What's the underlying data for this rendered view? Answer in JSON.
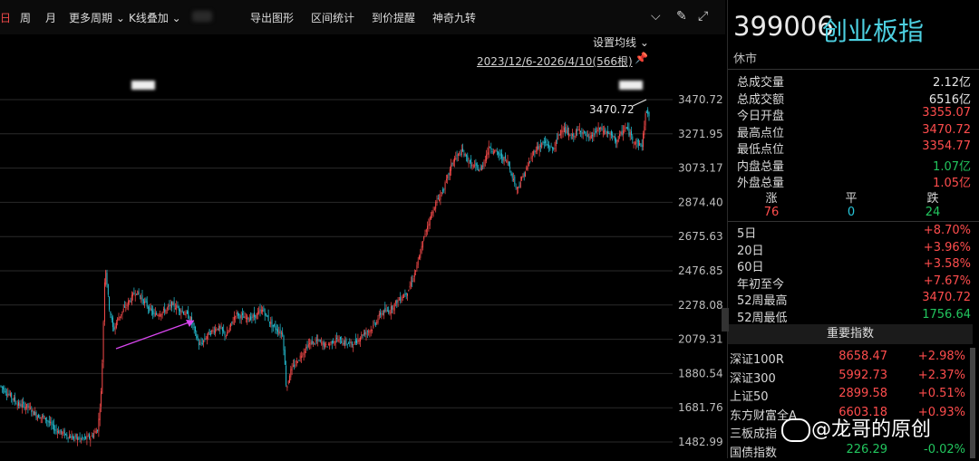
{
  "toolbar": {
    "period_partial": "日",
    "week": "周",
    "month": "月",
    "more_periods": "更多周期 ⌄",
    "kline_overlay": "K线叠加 ⌄",
    "export": "导出图形",
    "range_stats": "区间统计",
    "price_alert": "到价提醒",
    "magic_nine": "神奇九转"
  },
  "chart_header": {
    "ma_setting": "设置均线 ⌄",
    "date_range": "2023/12/6-2026/4/10(566根)"
  },
  "chart_data": {
    "type": "candlestick",
    "y_ticks": [
      "3470.72",
      "3271.95",
      "3073.17",
      "2874.40",
      "2675.63",
      "2476.85",
      "2278.08",
      "2079.31",
      "1880.54",
      "1681.76",
      "1482.99"
    ],
    "ylim": [
      1482.99,
      3470.72
    ],
    "annotation": "3470.72",
    "up_color": "#ff4d4d",
    "down_color": "#26c6da",
    "trend_arrow_color": "#d946ef",
    "path": [
      [
        0,
        1810
      ],
      [
        10,
        1760
      ],
      [
        20,
        1700
      ],
      [
        30,
        1690
      ],
      [
        40,
        1640
      ],
      [
        50,
        1620
      ],
      [
        60,
        1560
      ],
      [
        70,
        1530
      ],
      [
        80,
        1510
      ],
      [
        90,
        1500
      ],
      [
        100,
        1510
      ],
      [
        108,
        1560
      ],
      [
        112,
        1800
      ],
      [
        116,
        2530
      ],
      [
        120,
        2280
      ],
      [
        125,
        2130
      ],
      [
        130,
        2200
      ],
      [
        140,
        2280
      ],
      [
        150,
        2360
      ],
      [
        160,
        2290
      ],
      [
        170,
        2220
      ],
      [
        180,
        2240
      ],
      [
        190,
        2280
      ],
      [
        200,
        2250
      ],
      [
        210,
        2200
      ],
      [
        220,
        2040
      ],
      [
        230,
        2110
      ],
      [
        240,
        2150
      ],
      [
        250,
        2100
      ],
      [
        260,
        2230
      ],
      [
        270,
        2200
      ],
      [
        280,
        2210
      ],
      [
        290,
        2250
      ],
      [
        300,
        2160
      ],
      [
        312,
        2110
      ],
      [
        316,
        1790
      ],
      [
        320,
        1890
      ],
      [
        330,
        1970
      ],
      [
        340,
        2050
      ],
      [
        350,
        2070
      ],
      [
        360,
        2040
      ],
      [
        370,
        2080
      ],
      [
        380,
        2060
      ],
      [
        390,
        2050
      ],
      [
        400,
        2110
      ],
      [
        410,
        2140
      ],
      [
        420,
        2230
      ],
      [
        430,
        2250
      ],
      [
        440,
        2310
      ],
      [
        450,
        2360
      ],
      [
        460,
        2500
      ],
      [
        470,
        2720
      ],
      [
        480,
        2860
      ],
      [
        490,
        2960
      ],
      [
        500,
        3120
      ],
      [
        510,
        3170
      ],
      [
        520,
        3090
      ],
      [
        530,
        3060
      ],
      [
        540,
        3200
      ],
      [
        550,
        3150
      ],
      [
        560,
        3110
      ],
      [
        570,
        2950
      ],
      [
        580,
        3060
      ],
      [
        590,
        3180
      ],
      [
        600,
        3220
      ],
      [
        610,
        3180
      ],
      [
        620,
        3310
      ],
      [
        630,
        3250
      ],
      [
        640,
        3300
      ],
      [
        650,
        3240
      ],
      [
        660,
        3300
      ],
      [
        670,
        3280
      ],
      [
        680,
        3230
      ],
      [
        690,
        3310
      ],
      [
        700,
        3230
      ],
      [
        708,
        3200
      ],
      [
        713,
        3420
      ],
      [
        716,
        3360
      ]
    ]
  },
  "quote": {
    "code": "399006",
    "name": "创业板指",
    "status": "休市",
    "rows": [
      {
        "k": "总成交量",
        "v": "2.12亿",
        "c": "#e6e6e6"
      },
      {
        "k": "总成交额",
        "v": "6516亿",
        "c": "#e6e6e6"
      },
      {
        "k": "今日开盘",
        "v": "3355.07",
        "c": "#ff4d4d"
      },
      {
        "k": "最高点位",
        "v": "3470.72",
        "c": "#ff4d4d"
      },
      {
        "k": "最低点位",
        "v": "3354.77",
        "c": "#ff4d4d"
      },
      {
        "k": "内盘总量",
        "v": "1.07亿",
        "c": "#22c55e"
      },
      {
        "k": "外盘总量",
        "v": "1.05亿",
        "c": "#ff4d4d"
      }
    ],
    "up_label": "涨",
    "flat_label": "平",
    "down_label": "跌",
    "up_count": "76",
    "flat_count": "0",
    "down_count": "24",
    "perf": [
      {
        "k": "5日",
        "v": "+8.70%",
        "c": "#ff4d4d"
      },
      {
        "k": "20日",
        "v": "+3.96%",
        "c": "#ff4d4d"
      },
      {
        "k": "60日",
        "v": "+3.58%",
        "c": "#ff4d4d"
      },
      {
        "k": "年初至今",
        "v": "+7.67%",
        "c": "#ff4d4d"
      },
      {
        "k": "52周最高",
        "v": "3470.72",
        "c": "#ff4d4d"
      },
      {
        "k": "52周最低",
        "v": "1756.64",
        "c": "#22c55e"
      }
    ]
  },
  "indices": {
    "title": "重要指数",
    "items": [
      {
        "n": "深证100R",
        "p": "8658.47",
        "c": "+2.98%",
        "col": "#ff4d4d"
      },
      {
        "n": "深证300",
        "p": "5992.73",
        "c": "+2.37%",
        "col": "#ff4d4d"
      },
      {
        "n": "上证50",
        "p": "2899.58",
        "c": "+0.51%",
        "col": "#ff4d4d"
      },
      {
        "n": "东方财富全A",
        "p": "6603.18",
        "c": "+0.93%",
        "col": "#ff4d4d"
      },
      {
        "n": "三板成指",
        "p": "",
        "c": "",
        "col": "#ff4d4d"
      },
      {
        "n": "国债指数",
        "p": "226.29",
        "c": "-0.02%",
        "col": "#22c55e"
      }
    ]
  },
  "watermark": "@龙哥的原创"
}
